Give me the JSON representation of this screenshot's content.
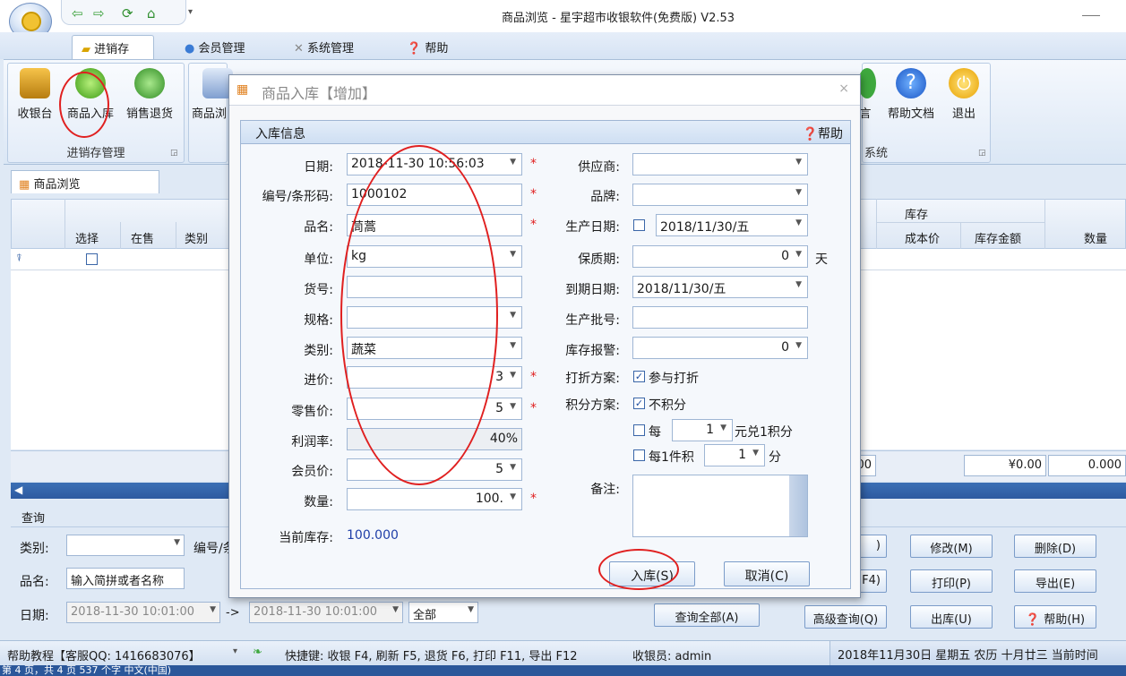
{
  "window": {
    "title": "商品浏览 - 星宇超市收银软件(免费版) V2.53"
  },
  "ribbon": {
    "tabs": [
      {
        "label": "进销存"
      },
      {
        "label": "会员管理"
      },
      {
        "label": "系统管理"
      },
      {
        "label": "帮助"
      }
    ],
    "groups": [
      {
        "label": "进销存管理"
      },
      {
        "label": "系统"
      }
    ],
    "buttons": [
      {
        "label": "收银台"
      },
      {
        "label": "商品入库"
      },
      {
        "label": "销售退货"
      },
      {
        "label": "商品浏"
      },
      {
        "label": "言"
      },
      {
        "label": "帮助文档"
      },
      {
        "label": "退出"
      }
    ]
  },
  "doc_tab": {
    "label": "商品浏览"
  },
  "grid": {
    "headers": {
      "select": "选择",
      "on_sale": "在售",
      "category": "类别",
      "stock_group": "库存",
      "cost": "成本价",
      "stock_amount": "库存金额",
      "quantity": "数量"
    },
    "footer": {
      "partial": "00",
      "amount": "¥0.00",
      "qty": "0.000"
    }
  },
  "query": {
    "title": "查询",
    "category_label": "类别:",
    "code_label": "编号/条",
    "name_label": "品名:",
    "name_value": "输入简拼或者名称",
    "date_label": "日期:",
    "date_from": "2018-11-30 10:01:00",
    "arrow": "->",
    "date_to": "2018-11-30 10:01:00",
    "scope": "全部",
    "buttons": {
      "hidden1": ")",
      "modify": "修改(M)",
      "delete": "删除(D)",
      "hidden2": "F4)",
      "print": "打印(P)",
      "export": "导出(E)",
      "query_all": "查询全部(A)",
      "advanced": "高级查询(Q)",
      "outbound": "出库(U)",
      "help": "帮助(H)"
    }
  },
  "status": {
    "left": "帮助教程【客服QQ: 1416683076】",
    "shortcuts": "快捷键: 收银 F4, 刷新 F5, 退货 F6, 打印 F11, 导出 F12",
    "cashier": "收银员: admin",
    "date": "2018年11月30日 星期五 农历 十月廿三 当前时间"
  },
  "ime": {
    "text": "第 4 页，共 4 页    537 个字    中文(中国)"
  },
  "dialog": {
    "title": "商品入库【增加】",
    "group_title": "入库信息",
    "help": "帮助",
    "fields": {
      "date": {
        "label": "日期:",
        "value": "2018-11-30 10:56:03"
      },
      "code": {
        "label": "编号/条形码:",
        "value": "1000102"
      },
      "name": {
        "label": "品名:",
        "value": "茼蒿"
      },
      "unit": {
        "label": "单位:",
        "value": "kg"
      },
      "item_no": {
        "label": "货号:",
        "value": ""
      },
      "spec": {
        "label": "规格:",
        "value": ""
      },
      "category": {
        "label": "类别:",
        "value": "蔬菜"
      },
      "purchase_price": {
        "label": "进价:",
        "value": "3"
      },
      "retail_price": {
        "label": "零售价:",
        "value": "5"
      },
      "profit": {
        "label": "利润率:",
        "value": "40%"
      },
      "member_price": {
        "label": "会员价:",
        "value": "5"
      },
      "quantity": {
        "label": "数量:",
        "value": "100."
      },
      "current_stock": {
        "label": "当前库存:",
        "value": "100.000"
      },
      "supplier": {
        "label": "供应商:",
        "value": ""
      },
      "brand": {
        "label": "品牌:",
        "value": ""
      },
      "prod_date": {
        "label": "生产日期:",
        "value": "2018/11/30/五"
      },
      "shelf_life": {
        "label": "保质期:",
        "value": "0",
        "unit": "天"
      },
      "expire_date": {
        "label": "到期日期:",
        "value": "2018/11/30/五"
      },
      "batch": {
        "label": "生产批号:",
        "value": ""
      },
      "stock_alarm": {
        "label": "库存报警:",
        "value": "0"
      },
      "discount": {
        "label": "打折方案:",
        "value": "参与打折"
      },
      "points": {
        "label": "积分方案:",
        "value": "不积分"
      },
      "per_yuan": {
        "prefix": "每",
        "value": "1",
        "suffix": "元兑1积分"
      },
      "per_item": {
        "prefix": "每1件积",
        "value": "1",
        "suffix": "分"
      },
      "remark": {
        "label": "备注:"
      }
    },
    "buttons": {
      "ok": "入库(S)",
      "cancel": "取消(C)"
    }
  },
  "colors": {
    "accent": "#2b579a",
    "required": "#e02020",
    "stock_value": "#1f3fa8"
  }
}
